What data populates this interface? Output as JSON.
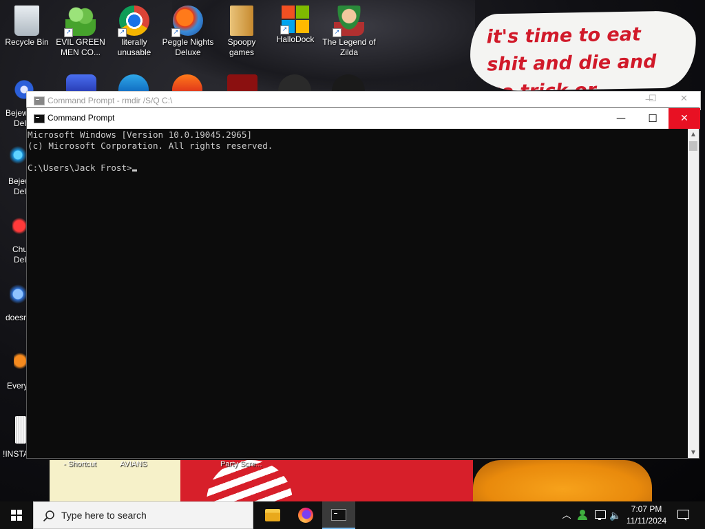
{
  "desktop": {
    "icons_top": [
      {
        "label": "Recycle Bin",
        "icon": "recycle-bin-icon"
      },
      {
        "label": "EVIL GREEN MEN CO...",
        "icon": "green-men-icon"
      },
      {
        "label": "literally unusable",
        "icon": "chrome-icon"
      },
      {
        "label": "Peggle Nights Deluxe",
        "icon": "peggle-icon"
      },
      {
        "label": "Spoopy games",
        "icon": "folder-icon"
      },
      {
        "label": "HalloDock",
        "icon": "windows-logo-icon"
      },
      {
        "label": "The Legend of Zilda",
        "icon": "zilda-icon"
      }
    ],
    "icons_left": [
      {
        "label_a": "Bejew",
        "label_b": "Del"
      },
      {
        "label_a": "Bejew",
        "label_b": "Del"
      },
      {
        "label_a": "Chu",
        "label_b": "Del"
      },
      {
        "label_a": "doesn",
        "label_b": ""
      },
      {
        "label_a": "Every",
        "label_b": ""
      },
      {
        "label_a": "!INSTA",
        "label_b": ""
      }
    ],
    "background_note": "it's time to eat shit and die and go trick or treating and vote!",
    "bottom_captions": [
      "- Shortcut",
      "AVIANS",
      "Party Scre..."
    ]
  },
  "window_back": {
    "title": "Command Prompt - rmdir /S/Q C:\\"
  },
  "window": {
    "title": "Command Prompt",
    "minimize_glyph": "—",
    "maximize_glyph": "☐",
    "close_glyph": "✕",
    "console_lines": [
      "Microsoft Windows [Version 10.0.19045.2965]",
      "(c) Microsoft Corporation. All rights reserved.",
      "",
      "C:\\Users\\Jack Frost>"
    ]
  },
  "taskbar": {
    "search_placeholder": "Type here to search",
    "apps": [
      "file-explorer-icon",
      "firefox-icon",
      "command-prompt-icon"
    ],
    "time": "7:07 PM",
    "date": "11/11/2024"
  },
  "colors": {
    "console_bg": "#0c0c0c",
    "console_text": "#cccccc",
    "close_red": "#e81123",
    "note_text": "#d11a2a"
  }
}
